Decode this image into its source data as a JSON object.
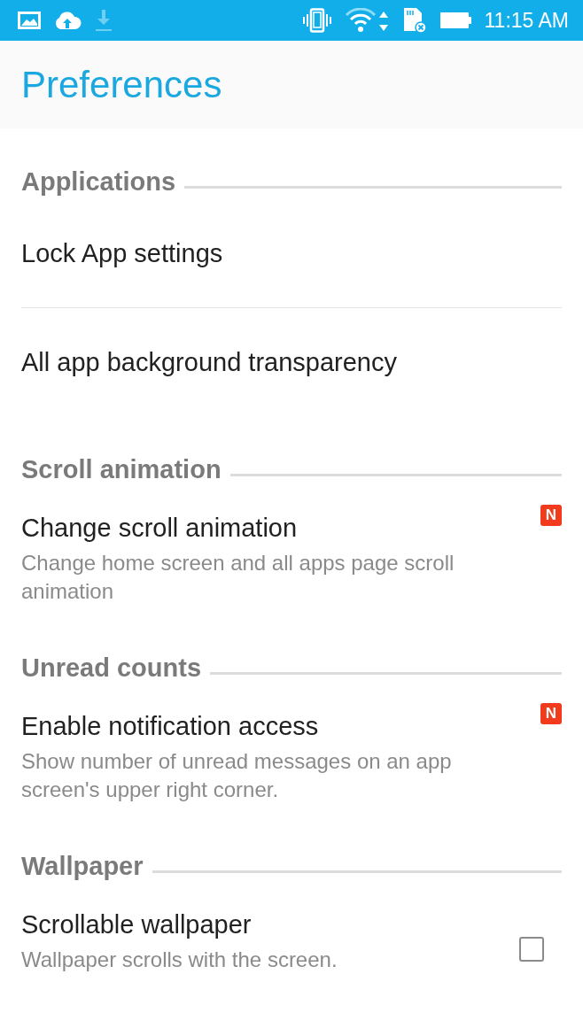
{
  "status_bar": {
    "time": "11:15 AM"
  },
  "header": {
    "title": "Preferences"
  },
  "sections": [
    {
      "title": "Applications",
      "items": [
        {
          "kind": "plain",
          "title": "Lock App settings"
        },
        {
          "kind": "divider"
        },
        {
          "kind": "plain",
          "title": "All app background transparency"
        }
      ]
    },
    {
      "title": "Scroll animation",
      "items": [
        {
          "kind": "badge",
          "title": "Change scroll animation",
          "summary": "Change home screen and all apps page scroll animation",
          "badge": "N"
        }
      ]
    },
    {
      "title": "Unread counts",
      "items": [
        {
          "kind": "badge",
          "title": "Enable notification access",
          "summary": "Show number of unread messages on an app screen's upper right corner.",
          "badge": "N"
        }
      ]
    },
    {
      "title": "Wallpaper",
      "items": [
        {
          "kind": "checkbox",
          "title": "Scrollable wallpaper",
          "summary": "Wallpaper scrolls with the screen.",
          "checked": false
        }
      ]
    }
  ]
}
